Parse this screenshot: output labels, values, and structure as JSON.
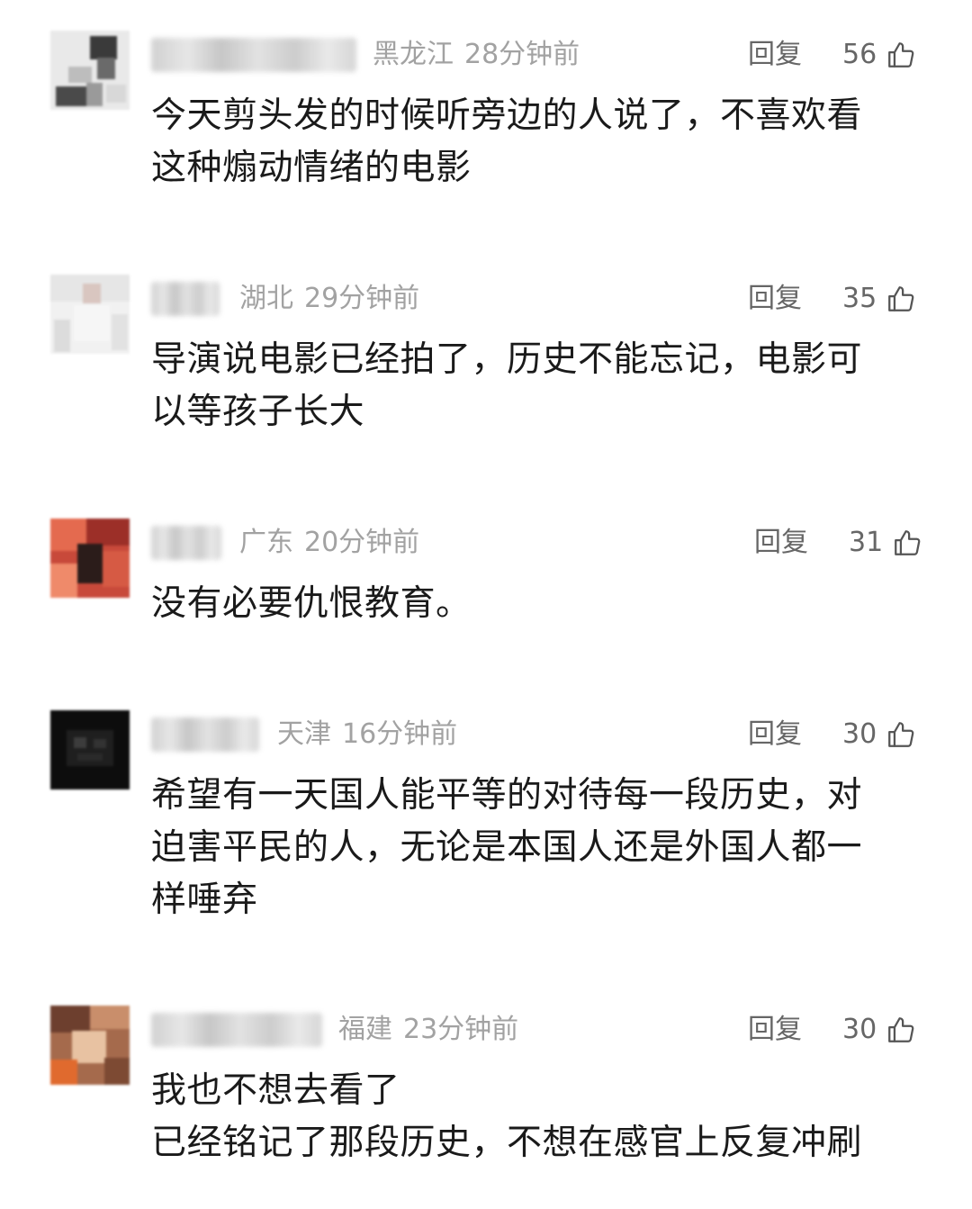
{
  "comments": [
    {
      "location": "黑龙江",
      "time": "28分钟前",
      "reply_label": "回复",
      "likes": "56",
      "avatar_icon": "avatar-icon",
      "lines": [
        "今天剪头发的时候听旁边的人说了，不喜欢看",
        "这种煽动情绪的电影"
      ]
    },
    {
      "location": "湖北",
      "time": "29分钟前",
      "reply_label": "回复",
      "likes": "35",
      "avatar_icon": "avatar-icon",
      "lines": [
        "导演说电影已经拍了，历史不能忘记，电影可",
        "以等孩子长大"
      ]
    },
    {
      "location": "广东",
      "time": "20分钟前",
      "reply_label": "回复",
      "likes": "31",
      "avatar_icon": "avatar-icon",
      "lines": [
        "没有必要仇恨教育。"
      ]
    },
    {
      "location": "天津",
      "time": "16分钟前",
      "reply_label": "回复",
      "likes": "30",
      "avatar_icon": "avatar-icon",
      "lines": [
        "希望有一天国人能平等的对待每一段历史，对",
        "迫害平民的人，无论是本国人还是外国人都一",
        "样唾弃"
      ]
    },
    {
      "location": "福建",
      "time": "23分钟前",
      "reply_label": "回复",
      "likes": "30",
      "avatar_icon": "avatar-icon",
      "lines": [
        "我也不想去看了",
        "已经铭记了那段历史，不想在感官上反复冲刷"
      ]
    }
  ],
  "colors": {
    "meta": "#a2a2a2",
    "action": "#666666",
    "body_text": "#1a1a1a"
  }
}
